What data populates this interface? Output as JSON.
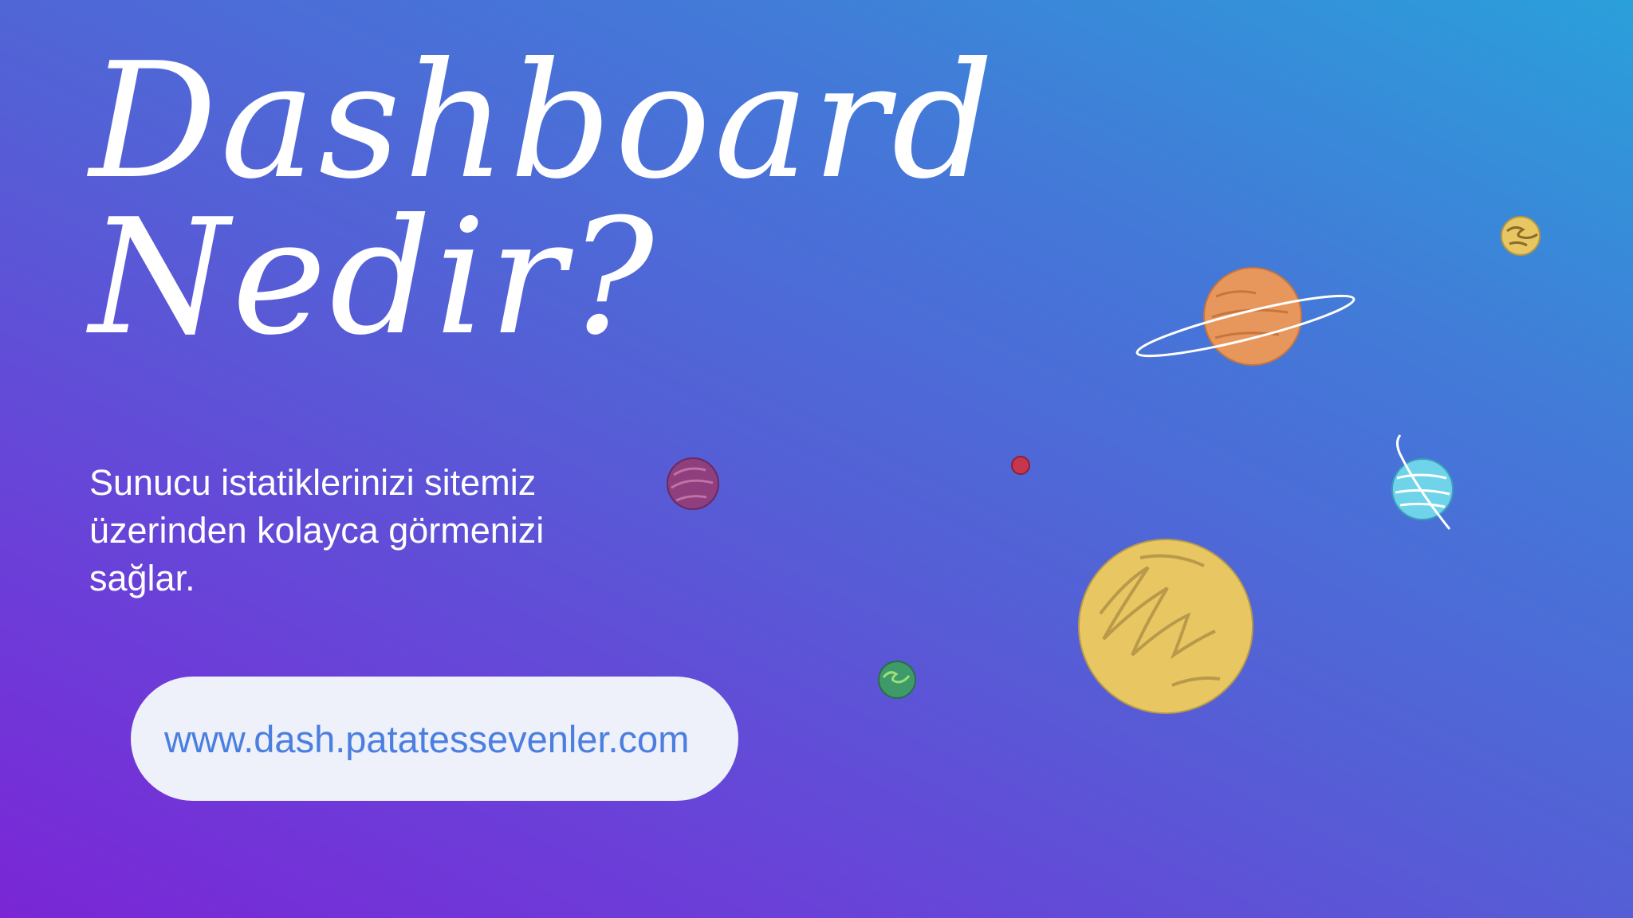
{
  "hero": {
    "title_line1": "Dashboard",
    "title_line2": "Nedir?",
    "subtitle": "Sunucu istatiklerinizi sitemiz üzerinden kolayca görmenizi sağlar.",
    "url": "www.dash.patatessevenler.com"
  },
  "colors": {
    "gradient_start": "#7a26d6",
    "gradient_end": "#2aa0da",
    "pill_background": "#eef0fa",
    "pill_text": "#4a7fe0",
    "planet_orange": "#e8975c",
    "planet_yellow": "#e8c662",
    "planet_cyan": "#6fd4ea",
    "planet_purple": "#8f3f7e",
    "planet_red": "#c6364f",
    "planet_green": "#3f9a6a"
  },
  "illustration": {
    "planets": [
      "ringed-orange-planet",
      "large-yellow-planet",
      "small-yellow-planet",
      "cyan-ringed-planet",
      "purple-planet",
      "small-red-planet",
      "green-planet"
    ]
  }
}
